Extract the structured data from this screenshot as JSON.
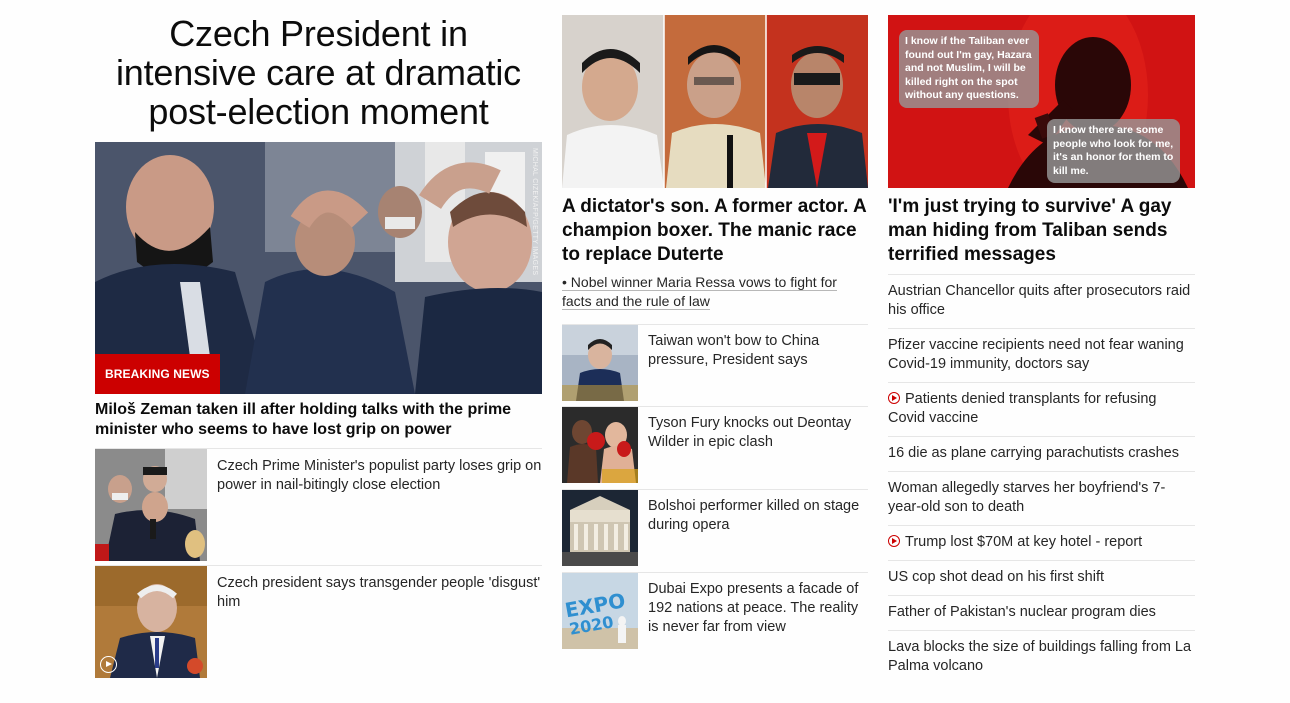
{
  "col1": {
    "headline": "Czech President in intensive care at dramatic post-election moment",
    "hero_credit": "MICHAL CIZEK/AFP/GETTY IMAGES",
    "breaking_label": "BREAKING NEWS",
    "hero_caption": "Miloš Zeman taken ill after holding talks with the prime minister who seems to have lost grip on power",
    "items": [
      {
        "text": "Czech Prime Minister's populist party loses grip on power in nail-bitingly close election"
      },
      {
        "text": "Czech president says transgender people 'disgust' him"
      }
    ]
  },
  "col2": {
    "headline": "A dictator's son. A former actor. A champion boxer. The manic race to replace Duterte",
    "sub": "• Nobel winner Maria Ressa vows to fight for facts and the rule of law",
    "items": [
      {
        "text": "Taiwan won't bow to China pressure, President says"
      },
      {
        "text": "Tyson Fury knocks out Deontay Wilder in epic clash"
      },
      {
        "text": "Bolshoi performer killed on stage during opera"
      },
      {
        "text": "Dubai Expo presents a facade of 192 nations at peace. The reality is never far from view"
      }
    ]
  },
  "col3": {
    "bubble1": "I know if the Taliban ever found out I'm gay, Hazara and not Muslim, I will be killed right on the spot without any questions.",
    "bubble2": "I know there are some people who look for me, it's an honor for them to kill me.",
    "headline": "'I'm just trying to survive' A gay man hiding from Taliban sends terrified messages",
    "items": [
      {
        "text": "Austrian Chancellor quits after prosecutors raid his office"
      },
      {
        "text": "Pfizer vaccine recipients need not fear waning Covid-19 immunity, doctors say"
      },
      {
        "text": "Patients denied transplants for refusing Covid vaccine"
      },
      {
        "text": "16 die as plane carrying parachutists crashes"
      },
      {
        "text": "Woman allegedly starves her boyfriend's 7-year-old son to death"
      },
      {
        "text": "Trump lost $70M at key hotel - report"
      },
      {
        "text": "US cop shot dead on his first shift"
      },
      {
        "text": "Father of Pakistan's nuclear program dies"
      },
      {
        "text": "Lava blocks the size of buildings falling from La Palma volcano"
      }
    ]
  },
  "colors": {
    "breaking": "#cc0000",
    "video_icon": "#cc0000",
    "text": "#262626",
    "divider": "#e6e6e6"
  }
}
